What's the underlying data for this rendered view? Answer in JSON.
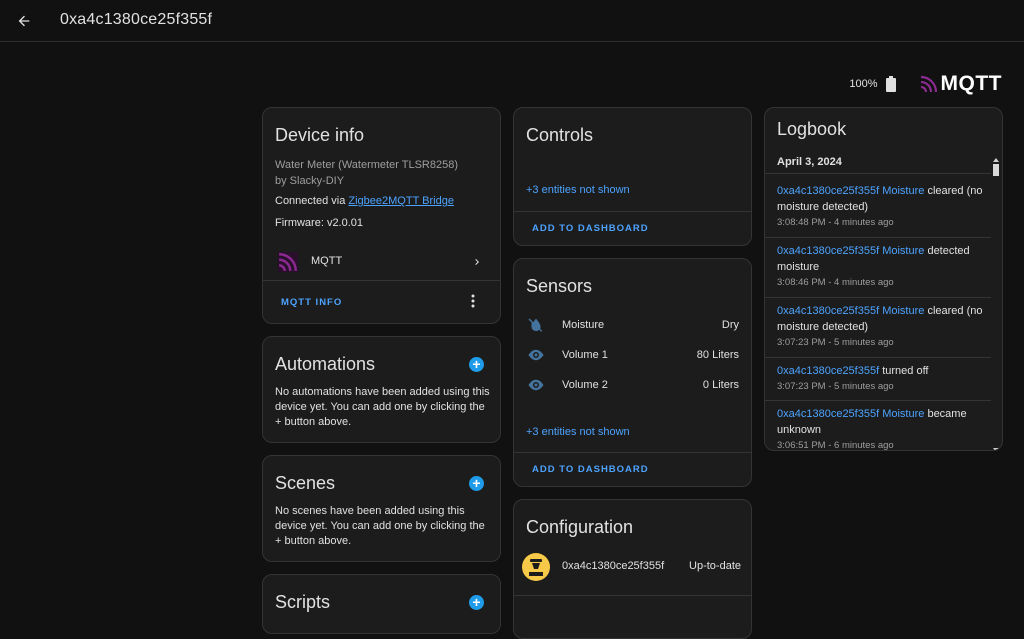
{
  "header": {
    "title": "0xa4c1380ce25f355f"
  },
  "status": {
    "battery": "100%",
    "integration_logo": "MQTT"
  },
  "device_info": {
    "title": "Device info",
    "model": "Water Meter (Watermeter TLSR8258)",
    "manufacturer": "by Slacky-DIY",
    "connected_prefix": "Connected via ",
    "connected_link": "Zigbee2MQTT Bridge",
    "firmware": "Firmware: v2.0.01",
    "integration": "MQTT",
    "action": "MQTT INFO"
  },
  "automations": {
    "title": "Automations",
    "text": "No automations have been added using this device yet. You can add one by clicking the + button above."
  },
  "scenes": {
    "title": "Scenes",
    "text": "No scenes have been added using this device yet. You can add one by clicking the + button above."
  },
  "scripts": {
    "title": "Scripts"
  },
  "controls": {
    "title": "Controls",
    "hidden": "+3 entities not shown",
    "action": "ADD TO DASHBOARD"
  },
  "sensors": {
    "title": "Sensors",
    "rows": [
      {
        "name": "Moisture",
        "value": "Dry",
        "icon": "water-off-icon"
      },
      {
        "name": "Volume 1",
        "value": "80 Liters",
        "icon": "eye-icon"
      },
      {
        "name": "Volume 2",
        "value": "0 Liters",
        "icon": "eye-icon"
      }
    ],
    "hidden": "+3 entities not shown",
    "action": "ADD TO DASHBOARD"
  },
  "configuration": {
    "title": "Configuration",
    "device": "0xa4c1380ce25f355f",
    "state": "Up-to-date"
  },
  "logbook": {
    "title": "Logbook",
    "date": "April 3, 2024",
    "entries": [
      {
        "entity": "0xa4c1380ce25f355f Moisture",
        "message": " cleared (no moisture detected)",
        "time": "3:08:48 PM - 4 minutes ago"
      },
      {
        "entity": "0xa4c1380ce25f355f Moisture",
        "message": " detected moisture",
        "time": "3:08:46 PM - 4 minutes ago"
      },
      {
        "entity": "0xa4c1380ce25f355f Moisture",
        "message": " cleared (no moisture detected)",
        "time": "3:07:23 PM - 5 minutes ago"
      },
      {
        "entity": "0xa4c1380ce25f355f",
        "message": " turned off",
        "time": "3:07:23 PM - 5 minutes ago"
      },
      {
        "entity": "0xa4c1380ce25f355f Moisture",
        "message": " became unknown",
        "time": "3:06:51 PM - 6 minutes ago"
      }
    ]
  },
  "colors": {
    "accent": "#4da3ff",
    "fab": "#1e9be9",
    "mqtt_purple": "#6a1a6e",
    "config_yellow": "#f7c948"
  }
}
